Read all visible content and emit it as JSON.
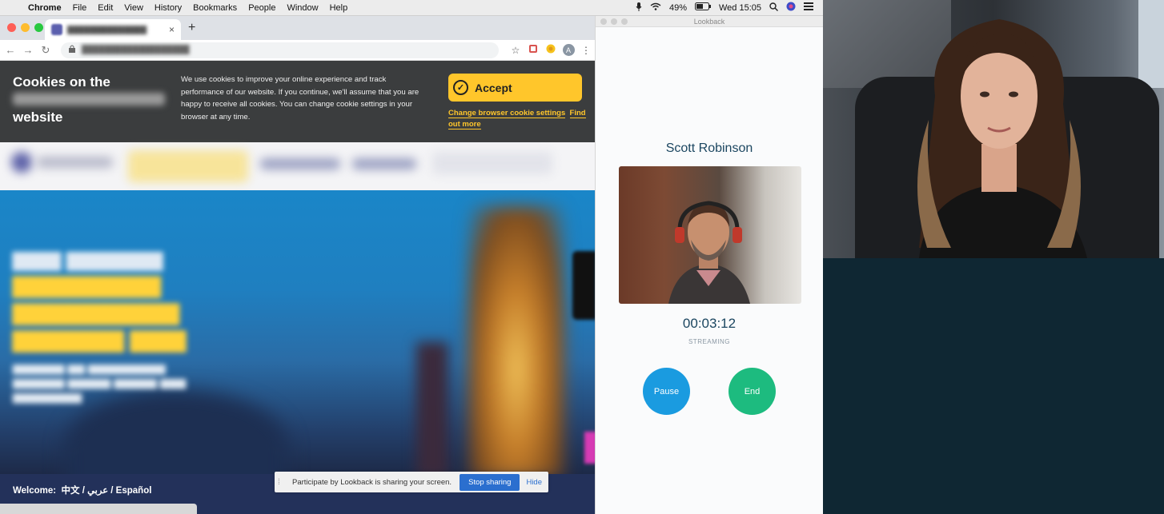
{
  "menubar": {
    "app": "Chrome",
    "menus": [
      "File",
      "Edit",
      "View",
      "History",
      "Bookmarks",
      "People",
      "Window",
      "Help"
    ],
    "battery": "49%",
    "clock": "Wed 15:05"
  },
  "browser": {
    "avatar_letter": "A"
  },
  "cookie_banner": {
    "title_line1": "Cookies on the",
    "title_line3": "website",
    "body": "We use cookies to improve your online experience and track performance of our website. If you continue, we'll assume that you are happy to receive all cookies. You can change cookie settings in your browser at any time.",
    "accept_label": "Accept",
    "link_change": "Change browser cookie settings",
    "link_find": "Find out more"
  },
  "site_footer": {
    "welcome": "Welcome:",
    "langs": "中文 / عربي / Español"
  },
  "share_bar": {
    "text": "Participate by Lookback is sharing your screen.",
    "stop_label": "Stop sharing",
    "hide_label": "Hide"
  },
  "lookback": {
    "window_title": "Lookback",
    "participant_name": "Scott Robinson",
    "timer": "00:03:12",
    "status": "STREAMING",
    "pause_label": "Pause",
    "end_label": "End",
    "pause_color": "#1a9be0",
    "end_color": "#1dbb7f"
  }
}
